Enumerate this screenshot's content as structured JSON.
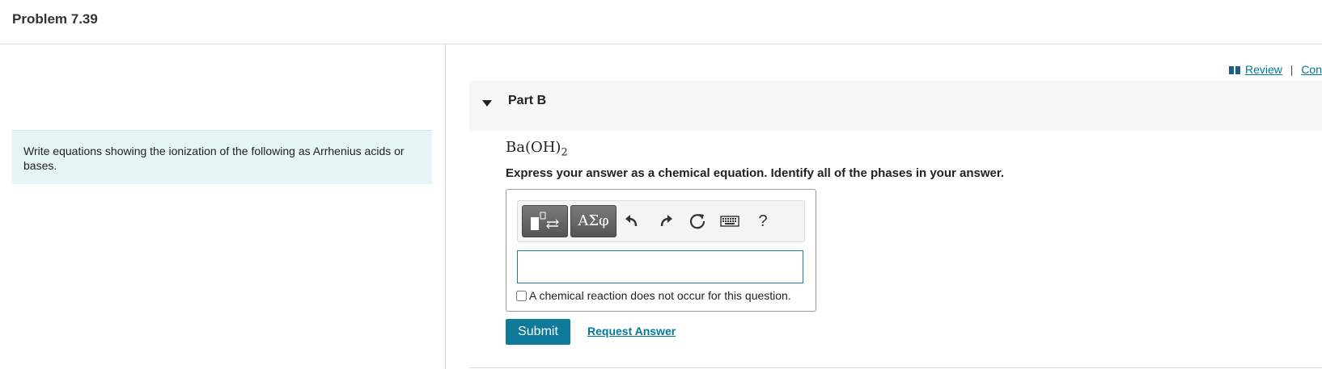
{
  "header": {
    "title": "Problem 7.39"
  },
  "intro": {
    "text": "Write equations showing the ionization of the following as Arrhenius acids or bases."
  },
  "links": {
    "review_label": "Review",
    "separator": "|",
    "constants_label": "Con"
  },
  "part": {
    "title": "Part B",
    "formula": {
      "base": "Ba(OH)",
      "subscript": "2"
    },
    "instructions": "Express your answer as a chemical equation. Identify all of the phases in your answer."
  },
  "toolbar": {
    "symbols_label": "ΑΣφ",
    "help_label": "?",
    "icons": [
      "templates-icon",
      "undo-icon",
      "redo-icon",
      "reset-icon",
      "keyboard-icon",
      "help-icon"
    ]
  },
  "answer": {
    "value": "",
    "placeholder": "",
    "no_reaction_label": "A chemical reaction does not occur for this question.",
    "no_reaction_checked": false
  },
  "actions": {
    "submit_label": "Submit",
    "request_label": "Request Answer"
  },
  "colors": {
    "accent": "#0f7a9a",
    "intro_bg": "#e6f5f5",
    "part_bg": "#f7f7f7"
  }
}
